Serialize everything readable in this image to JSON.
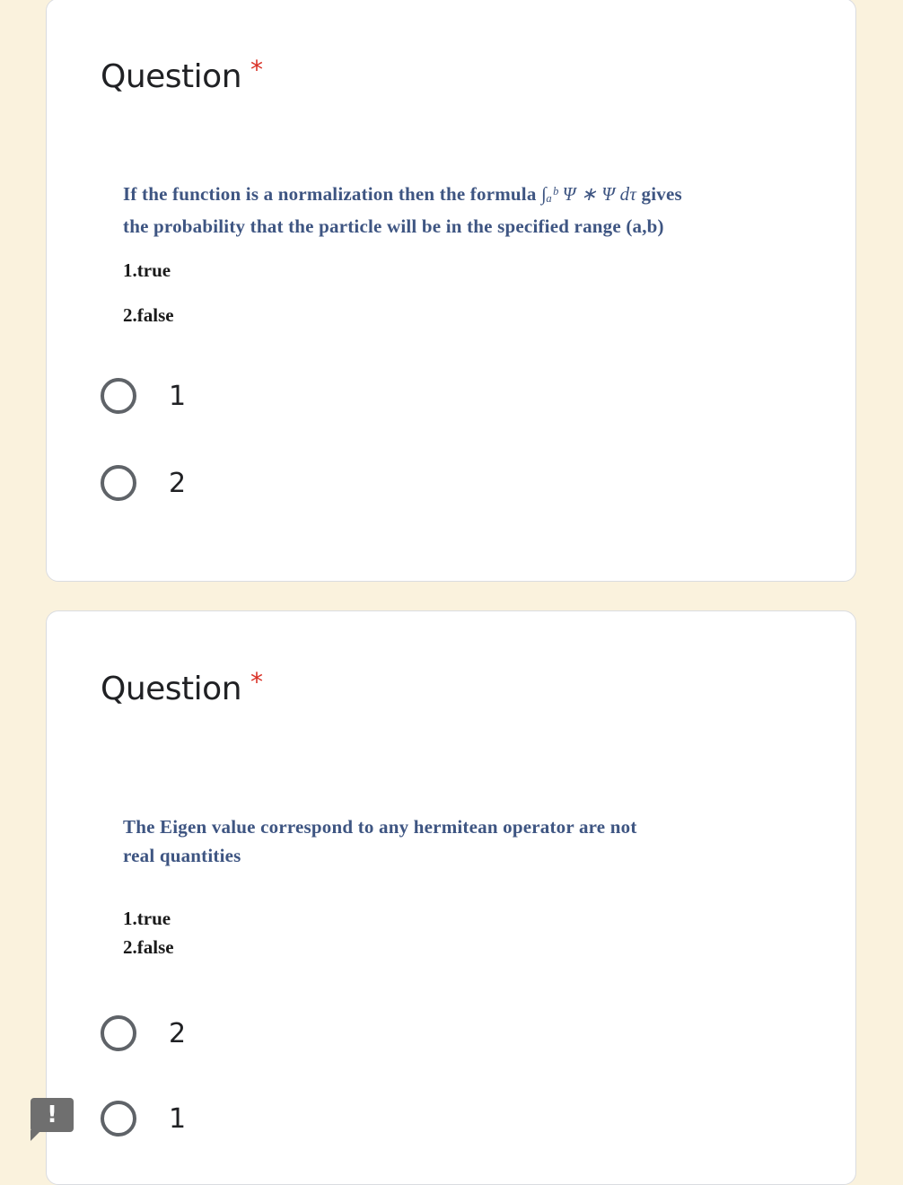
{
  "questions": [
    {
      "title": "Question",
      "required_mark": "*",
      "text_part1": "If the function is a normalization then the formula ",
      "formula": "∫ₐᵇ Ψ ∗ Ψ dτ",
      "text_part2": " gives",
      "text_line2": "the probability that the particle will be in the specified range (a,b)",
      "option_lines": [
        "1.true",
        "2.false"
      ],
      "choices": [
        "1",
        "2"
      ]
    },
    {
      "title": "Question",
      "required_mark": "*",
      "text_line1": "The Eigen value correspond to any hermitean operator are not",
      "text_line2": "real quantities",
      "option_lines": [
        "1.true",
        "2.false"
      ],
      "choices": [
        "2",
        "1"
      ]
    }
  ],
  "feedback_icon": "!"
}
